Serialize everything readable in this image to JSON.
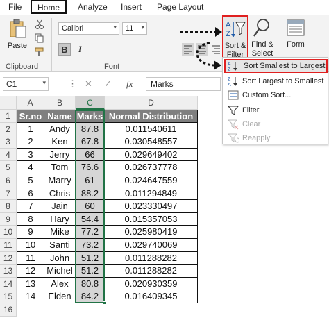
{
  "menu": {
    "file": "File",
    "home": "Home",
    "analyze": "Analyze",
    "insert": "Insert",
    "page_layout": "Page Layout"
  },
  "ribbon": {
    "paste_label": "Paste",
    "clipboard_label": "Clipboard",
    "font_name": "Calibri",
    "font_size": "11",
    "font_label": "Font",
    "sort_filter_line1": "Sort &",
    "sort_filter_line2": "Filter",
    "find_select_line1": "Find &",
    "find_select_line2": "Select",
    "form_label": "Form",
    "bold_glyph": "B",
    "italic_glyph": "I"
  },
  "sort_menu": {
    "items": [
      {
        "label": "Sort Smallest to Largest",
        "icon": "sort-ascending-icon"
      },
      {
        "label": "Sort Largest to Smallest",
        "icon": "sort-descending-icon"
      },
      {
        "label": "Custom Sort...",
        "icon": "custom-sort-icon"
      },
      {
        "label": "Filter",
        "icon": "filter-icon"
      },
      {
        "label": "Clear",
        "icon": "clear-filter-icon"
      },
      {
        "label": "Reapply",
        "icon": "reapply-icon"
      }
    ]
  },
  "formula_bar": {
    "name_box": "C1",
    "fx_symbol": "fx",
    "content": "Marks"
  },
  "sheet": {
    "columns": [
      "A",
      "B",
      "C",
      "D"
    ],
    "rows": [
      "1",
      "2",
      "3",
      "4",
      "5",
      "6",
      "7",
      "8",
      "9",
      "10",
      "11",
      "12",
      "13",
      "14",
      "15",
      "16"
    ],
    "header": [
      "Sr.no",
      "Name",
      "Marks",
      "Normal  Distribution"
    ],
    "data": [
      [
        "1",
        "Andy",
        "87.8",
        "0.011540611"
      ],
      [
        "2",
        "Ken",
        "67.8",
        "0.030548557"
      ],
      [
        "3",
        "Jerry",
        "66",
        "0.029649402"
      ],
      [
        "4",
        "Tom",
        "76.6",
        "0.026737778"
      ],
      [
        "5",
        "Marry",
        "61",
        "0.024647559"
      ],
      [
        "6",
        "Chris",
        "88.2",
        "0.011294849"
      ],
      [
        "7",
        "Jain",
        "60",
        "0.023330497"
      ],
      [
        "8",
        "Hary",
        "54.4",
        "0.015357053"
      ],
      [
        "9",
        "Mike",
        "77.2",
        "0.025980419"
      ],
      [
        "10",
        "Santi",
        "73.2",
        "0.029740069"
      ],
      [
        "11",
        "John",
        "51.2",
        "0.011288282"
      ],
      [
        "12",
        "Michel",
        "51.2",
        "0.011288282"
      ],
      [
        "13",
        "Alex",
        "80.8",
        "0.020930359"
      ],
      [
        "14",
        "Elden",
        "84.2",
        "0.016409345"
      ]
    ]
  },
  "colors": {
    "highlight_red": "#e02020",
    "header_gray": "#7f7f7f",
    "selected_column": "#d6d6d6",
    "green_selection": "#217346"
  }
}
